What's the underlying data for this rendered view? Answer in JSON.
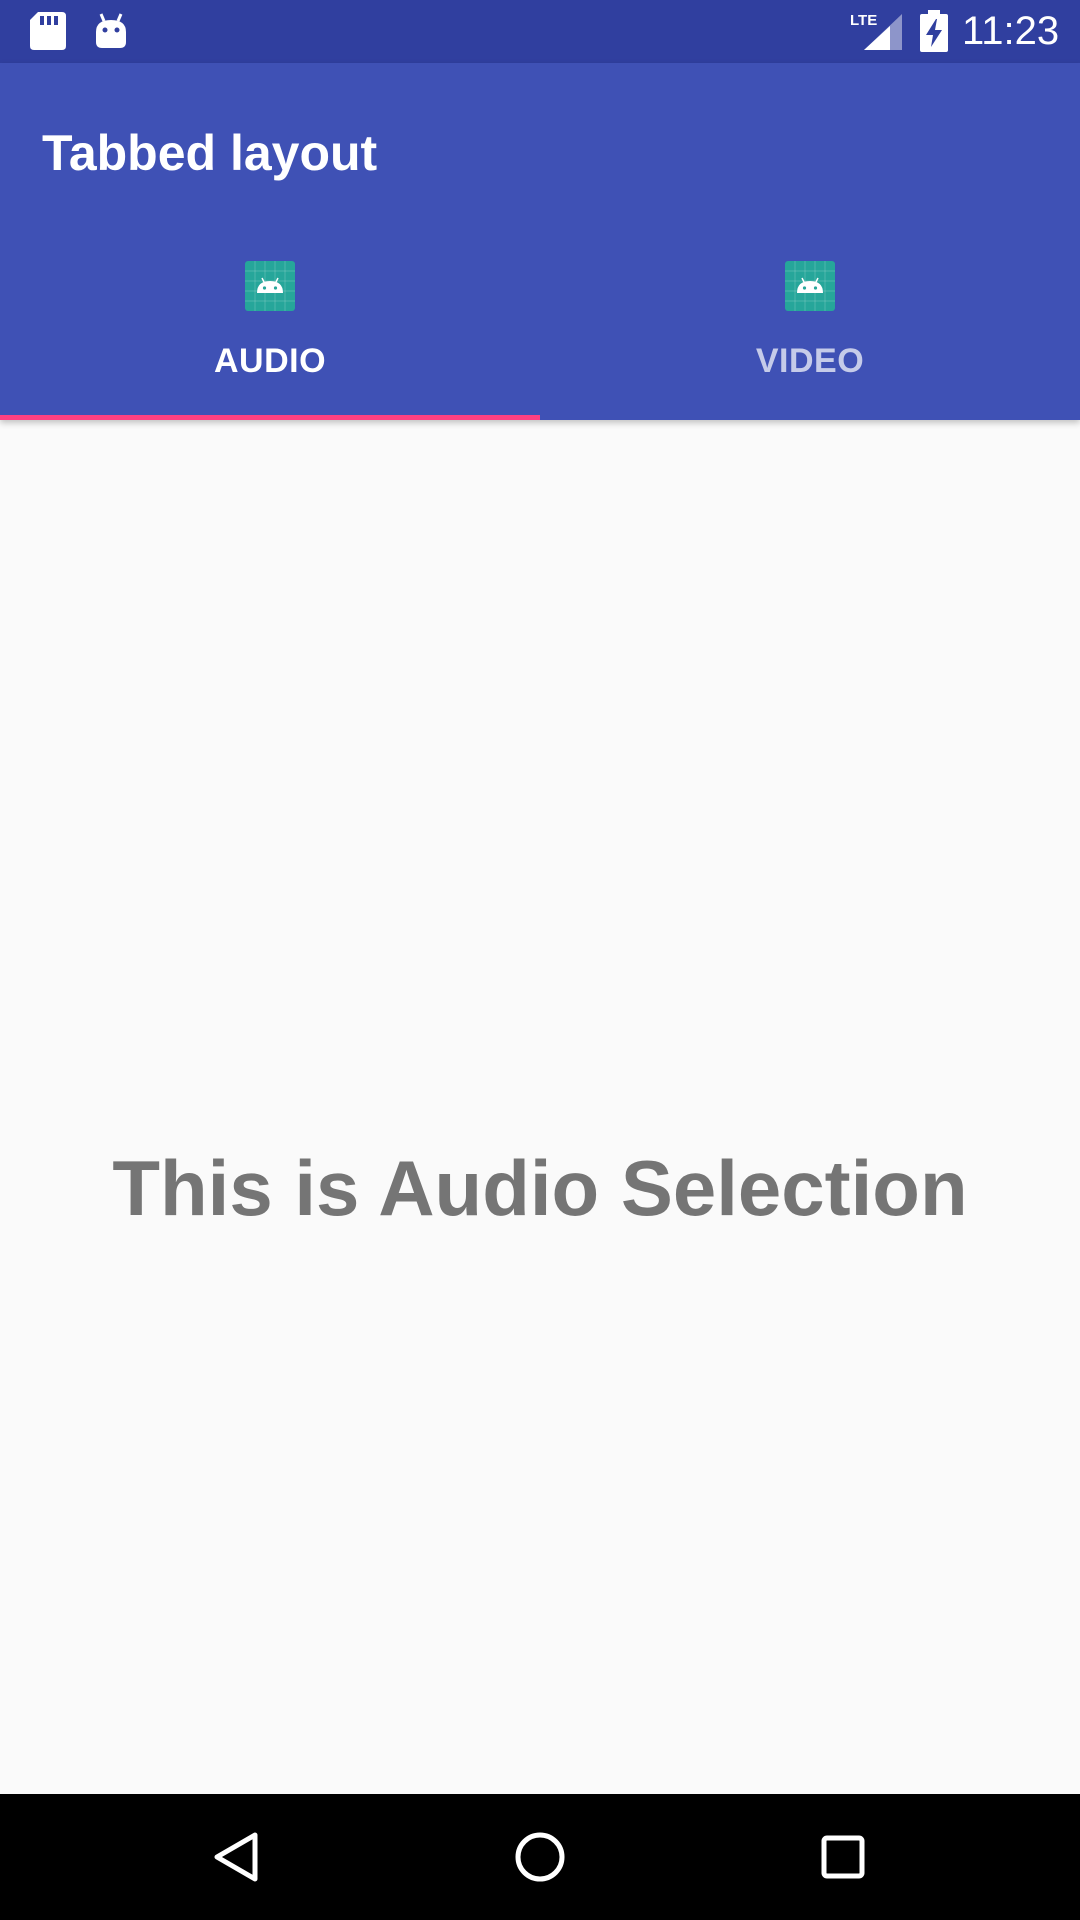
{
  "status_bar": {
    "time": "11:23",
    "network_label": "LTE",
    "icons": [
      "sd-card-icon",
      "android-icon",
      "lte-signal-icon",
      "battery-charging-icon"
    ]
  },
  "app_bar": {
    "title": "Tabbed layout"
  },
  "tabs": [
    {
      "label": "AUDIO",
      "icon": "android-launcher-icon",
      "selected": true
    },
    {
      "label": "VIDEO",
      "icon": "android-launcher-icon",
      "selected": false
    }
  ],
  "content": {
    "text": "This is Audio Selection"
  },
  "nav_bar": {
    "buttons": [
      "back-icon",
      "home-icon",
      "recents-icon"
    ]
  },
  "colors": {
    "status_bar": "#303f9f",
    "app_bar": "#3f51b5",
    "tab_indicator": "#ff4081",
    "content_text": "#757575",
    "background": "#fafafa",
    "icon_tile": "#26a69a"
  }
}
